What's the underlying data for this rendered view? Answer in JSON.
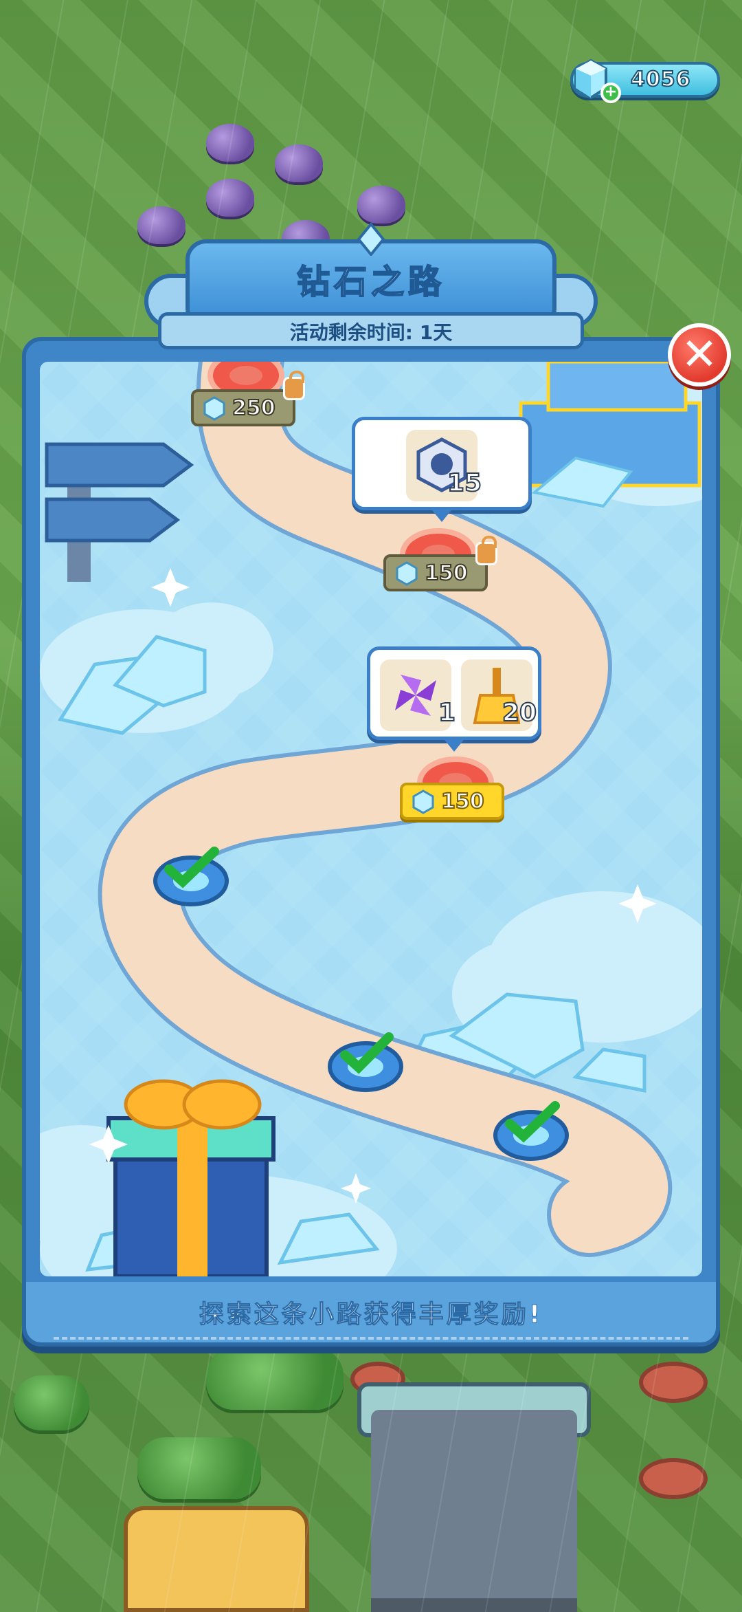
{
  "currency": {
    "amount": "4056",
    "icon": "diamond-icon"
  },
  "title": {
    "name": "钻石之路",
    "remaining": "活动剩余时间: 1天"
  },
  "close": {
    "label": "✕"
  },
  "footer": {
    "text": "探索这条小路获得丰厚奖励!"
  },
  "milestones": [
    {
      "price": "250",
      "state": "locked"
    },
    {
      "price": "150",
      "state": "locked",
      "rewards": [
        {
          "item": "gift-box-hex-icon",
          "count": "15"
        }
      ]
    },
    {
      "price": "150",
      "state": "active",
      "rewards": [
        {
          "item": "pinwheel-icon",
          "count": "1"
        },
        {
          "item": "broom-icon",
          "count": "20"
        }
      ]
    },
    {
      "state": "completed"
    },
    {
      "state": "completed"
    },
    {
      "state": "completed"
    }
  ],
  "colors": {
    "panel": "#3f86c9",
    "map": "#a7def5",
    "path": "#f7dcc4",
    "accent": "#ffd629"
  }
}
